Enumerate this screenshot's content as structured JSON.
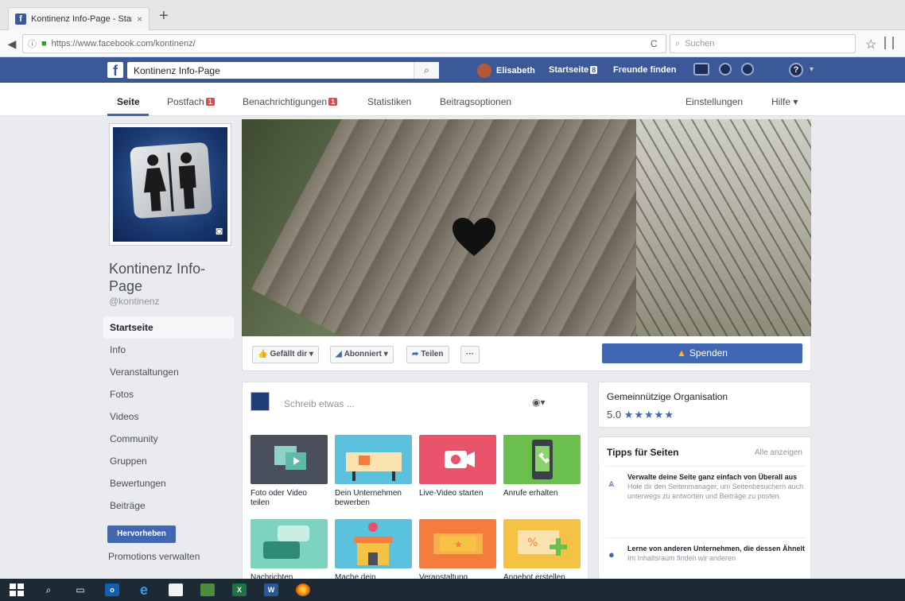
{
  "browser": {
    "tab_title": "Kontinenz Info-Page - Start",
    "tab_close": "×",
    "new_tab": "+",
    "url": "https://www.facebook.com/kontinenz/",
    "search_placeholder": "Suchen"
  },
  "fb_topbar": {
    "search_value": "Kontinenz Info-Page",
    "user_name": "Elisabeth",
    "home_label": "Startseite",
    "home_count": "8",
    "find_friends": "Freunde finden",
    "help_glyph": "?",
    "caret_glyph": "▾"
  },
  "subnav": {
    "seite": "Seite",
    "postfach": "Postfach",
    "postfach_badge": "1",
    "benachrichtigungen": "Benachrichtigungen",
    "benachrichtigungen_badge": "1",
    "statistiken": "Statistiken",
    "beitragsoptionen": "Beitragsoptionen",
    "einstellungen": "Einstellungen",
    "hilfe": "Hilfe ▾"
  },
  "page": {
    "name": "Kontinenz Info-Page",
    "handle": "@kontinenz"
  },
  "leftnav": {
    "items": [
      "Startseite",
      "Info",
      "Veranstaltungen",
      "Fotos",
      "Videos",
      "Community",
      "Gruppen",
      "Bewertungen",
      "Beiträge"
    ],
    "promote_button": "Hervorheben",
    "promotions_link": "Promotions verwalten"
  },
  "actions": {
    "like": "Gefällt dir ▾",
    "follow": "Abonniert ▾",
    "share": "Teilen",
    "more": "···",
    "donate": "Spenden"
  },
  "composer": {
    "placeholder": "Schreib etwas ...",
    "tiles": [
      {
        "label": "Foto oder Video teilen",
        "color": "#4a4f5c"
      },
      {
        "label": "Dein Unternehmen bewerben",
        "color": "#5bc2de"
      },
      {
        "label": "Live-Video starten",
        "color": "#e9546b"
      },
      {
        "label": "Anrufe erhalten",
        "color": "#6bbf4c"
      },
      {
        "label": "Nachrichten",
        "color": "#7dd3bf"
      },
      {
        "label": "Mache dein",
        "color": "#5bc2de"
      },
      {
        "label": "Veranstaltung",
        "color": "#f47c3c"
      },
      {
        "label": "Angebot erstellen",
        "color": "#f6c244"
      }
    ]
  },
  "org": {
    "type": "Gemeinnützige Organisation",
    "rating": "5.0",
    "stars": "★★★★★"
  },
  "tips": {
    "title": "Tipps für Seiten",
    "see_all": "Alle anzeigen",
    "items": [
      {
        "head": "Verwalte deine Seite ganz einfach von Überall aus",
        "body": "Hole dir den Seitenmanager, um Seitenbesuchern auch unterwegs zu antworten und Beiträge zu posten."
      },
      {
        "head": "Lerne von anderen Unternehmen, die dessen Ähnelt",
        "body": "Im Inhaltsraum finden wir anderen"
      }
    ]
  }
}
